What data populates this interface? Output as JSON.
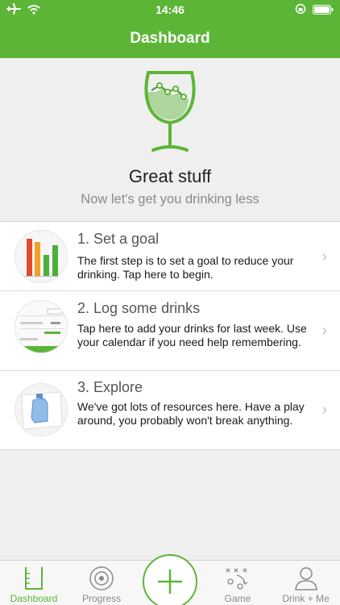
{
  "status_bar": {
    "time": "14:46",
    "icons": [
      "airplane-icon",
      "wifi-icon",
      "rotation-lock-icon",
      "battery-icon"
    ]
  },
  "header": {
    "title": "Dashboard"
  },
  "hero": {
    "icon": "wine-glass-chart-icon",
    "headline": "Great stuff",
    "subhead": "Now let's get you drinking less"
  },
  "steps": [
    {
      "title": "1. Set a goal",
      "description": "The first step is to set a goal to reduce your drinking. Tap here to begin.",
      "icon": "bar-chart-thumbnail"
    },
    {
      "title": "2. Log some drinks",
      "description": "Tap here to add your drinks for last week. Use your calendar if you need help remembering.",
      "icon": "drink-log-thumbnail"
    },
    {
      "title": "3. Explore",
      "description": "We've got lots of resources here. Have a play around, you probably won't break anything.",
      "icon": "resources-thumbnail"
    }
  ],
  "tab_bar": {
    "tabs": [
      {
        "label": "Dashboard",
        "icon": "glass-measure-icon",
        "active": true
      },
      {
        "label": "Progress",
        "icon": "target-icon",
        "active": false
      },
      {
        "label": "",
        "icon": "plus-icon",
        "active": false
      },
      {
        "label": "Game",
        "icon": "game-play-icon",
        "active": false
      },
      {
        "label": "Drink + Me",
        "icon": "person-icon",
        "active": false
      }
    ]
  },
  "colors": {
    "brand_green": "#5db538",
    "chart_red": "#e14b2c",
    "chart_orange": "#f0a02b",
    "chart_green": "#4caf3a"
  }
}
